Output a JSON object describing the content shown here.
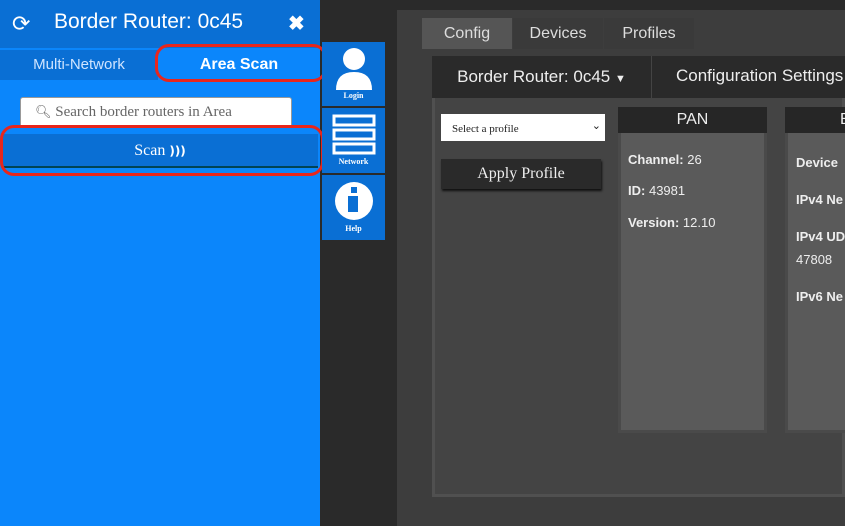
{
  "sidebar": {
    "title": "Border Router: 0c45",
    "tabs": [
      "Multi-Network",
      "Area Scan"
    ],
    "search_placeholder": "Search border routers in Area",
    "scan_label": "Scan"
  },
  "nav": [
    {
      "label": "Login",
      "icon": "user-icon"
    },
    {
      "label": "Network",
      "icon": "server-icon"
    },
    {
      "label": "Help",
      "icon": "info-icon"
    }
  ],
  "main": {
    "tabs": [
      "Config",
      "Devices",
      "Profiles"
    ],
    "router_select": "Border Router: 0c45",
    "section_title": "Configuration Settings",
    "profile_select": "Select a profile",
    "apply_label": "Apply Profile",
    "pan": {
      "title": "PAN",
      "rows": [
        {
          "k": "Channel:",
          "v": "26"
        },
        {
          "k": "ID:",
          "v": "43981"
        },
        {
          "k": "Version:",
          "v": "12.10"
        }
      ]
    },
    "card2": {
      "title": "B",
      "rows": [
        "Device",
        "IPv4 Ne",
        "IPv4 UD",
        "47808",
        "IPv6 Ne"
      ]
    }
  },
  "colors": {
    "sidebar": "#0b86fb",
    "highlight": "#e8261c"
  }
}
